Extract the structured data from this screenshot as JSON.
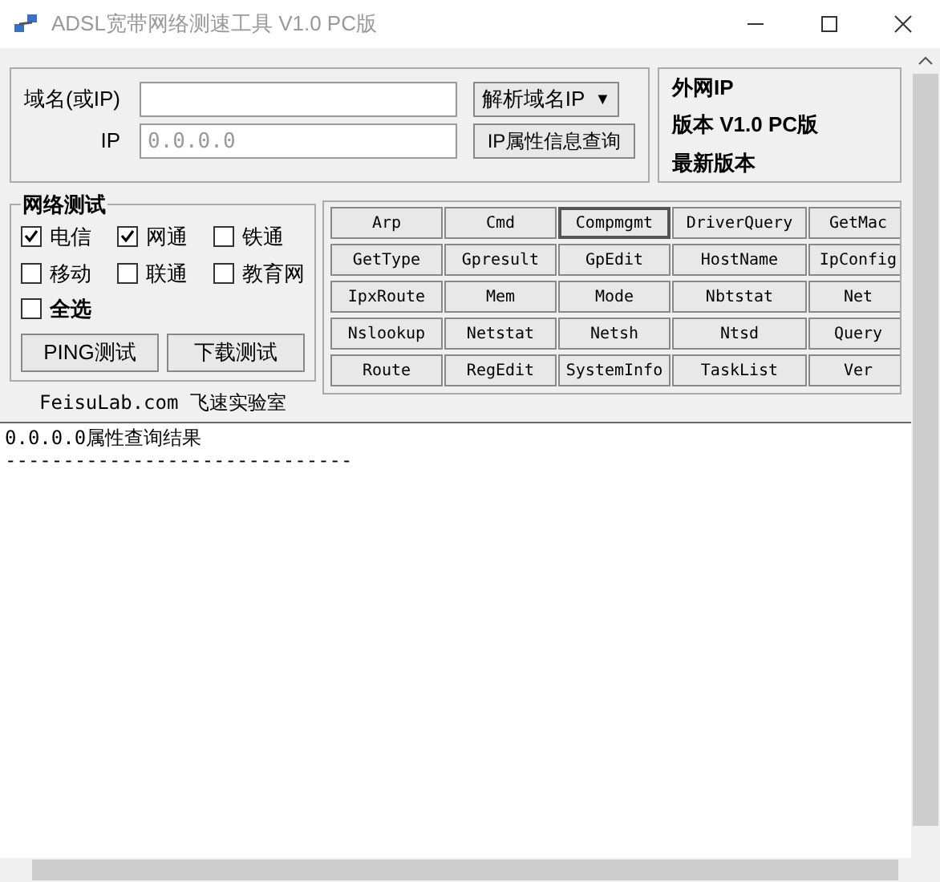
{
  "window": {
    "title": "ADSL宽带网络测速工具 V1.0 PC版"
  },
  "domain": {
    "label": "域名(或IP)"
  },
  "ip": {
    "label": "IP",
    "placeholder": "0.0.0.0"
  },
  "resolve_button": {
    "label": "解析域名IP",
    "caret": "▼"
  },
  "ip_info_button": {
    "label": "IP属性信息查询"
  },
  "info": [
    "外网IP",
    "版本 V1.0 PC版",
    "最新版本"
  ],
  "network_test": {
    "title": "网络测试",
    "options": [
      {
        "label": "电信",
        "checked": true
      },
      {
        "label": "网通",
        "checked": true
      },
      {
        "label": "铁通",
        "checked": false
      },
      {
        "label": "移动",
        "checked": false
      },
      {
        "label": "联通",
        "checked": false
      },
      {
        "label": "教育网",
        "checked": false
      }
    ],
    "select_all": {
      "label": "全选",
      "checked": false
    },
    "buttons": [
      "PING测试",
      "下载测试"
    ]
  },
  "footer": "FeisuLab.com 飞速实验室",
  "commands": [
    {
      "label": "Arp",
      "focused": false
    },
    {
      "label": "Cmd",
      "focused": false
    },
    {
      "label": "Compmgmt",
      "focused": true
    },
    {
      "label": "DriverQuery",
      "focused": false
    },
    {
      "label": "GetMac",
      "focused": false
    },
    {
      "label": "GetType",
      "focused": false
    },
    {
      "label": "Gpresult",
      "focused": false
    },
    {
      "label": "GpEdit",
      "focused": false
    },
    {
      "label": "HostName",
      "focused": false
    },
    {
      "label": "IpConfig",
      "focused": false
    },
    {
      "label": "IpxRoute",
      "focused": false
    },
    {
      "label": "Mem",
      "focused": false
    },
    {
      "label": "Mode",
      "focused": false
    },
    {
      "label": "Nbtstat",
      "focused": false
    },
    {
      "label": "Net",
      "focused": false
    },
    {
      "label": "Nslookup",
      "focused": false
    },
    {
      "label": "Netstat",
      "focused": false
    },
    {
      "label": "Netsh",
      "focused": false
    },
    {
      "label": "Ntsd",
      "focused": false
    },
    {
      "label": "Query",
      "focused": false
    },
    {
      "label": "Route",
      "focused": false
    },
    {
      "label": "RegEdit",
      "focused": false
    },
    {
      "label": "SystemInfo",
      "focused": false
    },
    {
      "label": "TaskList",
      "focused": false
    },
    {
      "label": "Ver",
      "focused": false
    }
  ],
  "output": [
    "0.0.0.0属性查询结果",
    "------------------------------"
  ]
}
